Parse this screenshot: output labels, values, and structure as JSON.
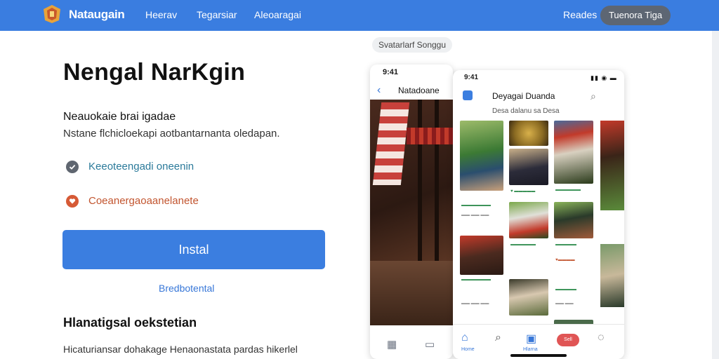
{
  "nav": {
    "brand": "Nataugain",
    "links": [
      "Heerav",
      "Tegarsiar",
      "Aleoaragai"
    ],
    "sign_in": "Reades",
    "cta": "Tuenora Tiga",
    "bar_color": "#3a7de0"
  },
  "hero": {
    "title": "Nengal NarKgin",
    "subheading": "Neauokaie brai igadae",
    "description": "Nstane flchicloekapi aotbantarnanta oledapan.",
    "features": [
      {
        "label": "Keeoteengadi oneenin",
        "icon": "check-icon",
        "color": "#2b7a9a"
      },
      {
        "label": "Coeanergaoaanelanete",
        "icon": "heart-icon",
        "color": "#c2552f"
      }
    ],
    "install_label": "Instal",
    "secondary_link": "Bredbotental"
  },
  "section": {
    "title": "Hlanatigsal oekstetian",
    "text": "Hicaturiansar dohakage Henaonastata pardas hikerlel"
  },
  "preview": {
    "chip": "Svatarlarf Songgu",
    "phone_a": {
      "time": "9:41",
      "title": "Natadoane"
    },
    "phone_b": {
      "time": "9:41",
      "title": "Deyagai Duanda",
      "subtitle": "Desa dalanu sa Desa",
      "tab_home": "Home",
      "tab_selected": "Sell",
      "tab_third": "Hlarna"
    }
  }
}
